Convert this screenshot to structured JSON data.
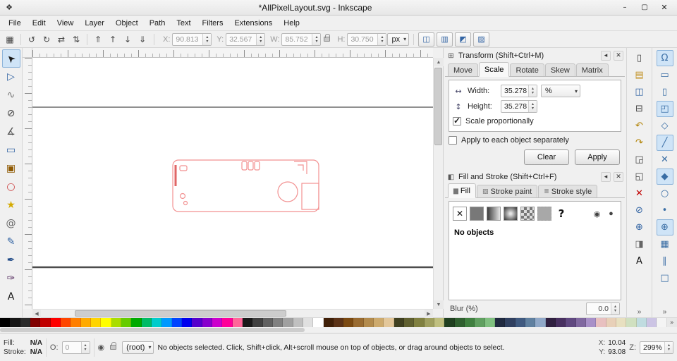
{
  "window": {
    "title": "*AllPixelLayout.svg - Inkscape",
    "icon_glyph": "❖",
    "controls": [
      {
        "name": "minimize-button",
        "glyph": "–"
      },
      {
        "name": "maximize-button",
        "glyph": "▢"
      },
      {
        "name": "close-button",
        "glyph": "✕"
      }
    ]
  },
  "menu": {
    "items": [
      {
        "name": "menu-file",
        "label": "File"
      },
      {
        "name": "menu-edit",
        "label": "Edit"
      },
      {
        "name": "menu-view",
        "label": "View"
      },
      {
        "name": "menu-layer",
        "label": "Layer"
      },
      {
        "name": "menu-object",
        "label": "Object"
      },
      {
        "name": "menu-path",
        "label": "Path"
      },
      {
        "name": "menu-text",
        "label": "Text"
      },
      {
        "name": "menu-filters",
        "label": "Filters"
      },
      {
        "name": "menu-extensions",
        "label": "Extensions"
      },
      {
        "name": "menu-help",
        "label": "Help"
      }
    ]
  },
  "toolbar": {
    "icons": [
      {
        "name": "select-all-button",
        "glyph": "▦"
      },
      {
        "name": "toolbar-separator",
        "cls": "sep"
      },
      {
        "name": "rotate-ccw-button",
        "glyph": "↺"
      },
      {
        "name": "rotate-cw-button",
        "glyph": "↻"
      },
      {
        "name": "flip-horizontal-button",
        "glyph": "⇄"
      },
      {
        "name": "flip-vertical-button",
        "glyph": "⇅"
      },
      {
        "name": "toolbar-separator",
        "cls": "sep"
      },
      {
        "name": "raise-to-top-button",
        "glyph": "⇑"
      },
      {
        "name": "raise-button",
        "glyph": "↑"
      },
      {
        "name": "lower-button",
        "glyph": "↓"
      },
      {
        "name": "lower-to-bottom-button",
        "glyph": "⇓"
      }
    ],
    "x_label": "X:",
    "x_value": "90.813",
    "y_label": "Y:",
    "y_value": "32.567",
    "w_label": "W:",
    "w_value": "85.752",
    "h_label": "H:",
    "h_value": "30.750",
    "unit": "px",
    "affect_toggles": [
      {
        "name": "transform-stroke-toggle",
        "glyph": "◫"
      },
      {
        "name": "transform-corners-toggle",
        "glyph": "▥"
      },
      {
        "name": "transform-gradient-toggle",
        "glyph": "◩"
      },
      {
        "name": "transform-pattern-toggle",
        "glyph": "▨"
      }
    ]
  },
  "toolbox": {
    "tools": [
      {
        "name": "tool-selector",
        "glyph": "➤",
        "fg": "#1a1a1a",
        "rotate": -135,
        "active": true
      },
      {
        "name": "tool-node-editor",
        "glyph": "▷",
        "fg": "#3465a4"
      },
      {
        "name": "tool-tweak",
        "glyph": "∿",
        "fg": "#777777"
      },
      {
        "name": "tool-zoom",
        "glyph": "⊘",
        "fg": "#444444"
      },
      {
        "name": "tool-measure",
        "glyph": "∡",
        "fg": "#555555"
      },
      {
        "name": "tool-rectangle",
        "glyph": "▭",
        "fg": "#3465a4"
      },
      {
        "name": "tool-3dbox",
        "glyph": "▣",
        "fg": "#8f5902"
      },
      {
        "name": "tool-ellipse",
        "glyph": "○",
        "fg": "#cc4444"
      },
      {
        "name": "tool-star",
        "glyph": "★",
        "fg": "#d4aa00"
      },
      {
        "name": "tool-spiral",
        "glyph": "@",
        "fg": "#666666"
      },
      {
        "name": "tool-pencil",
        "glyph": "✎",
        "fg": "#3465a4"
      },
      {
        "name": "tool-bezier-pen",
        "glyph": "✒",
        "fg": "#204a87"
      },
      {
        "name": "tool-calligraphy",
        "glyph": "✑",
        "fg": "#5c3566"
      },
      {
        "name": "tool-text",
        "glyph": "A",
        "fg": "#111111"
      }
    ]
  },
  "transform_panel": {
    "icon_glyph": "⊞",
    "title": "Transform (Shift+Ctrl+M)",
    "collapse_glyph": "◂",
    "close_glyph": "✕",
    "tabs": [
      {
        "name": "tab-move",
        "label": "Move"
      },
      {
        "name": "tab-scale",
        "label": "Scale",
        "active": true
      },
      {
        "name": "tab-rotate",
        "label": "Rotate"
      },
      {
        "name": "tab-skew",
        "label": "Skew"
      },
      {
        "name": "tab-matrix",
        "label": "Matrix"
      }
    ],
    "width_icon": "↔",
    "width_label": "Width:",
    "width_value": "35.278",
    "unit_value": "%",
    "height_icon": "↕",
    "height_label": "Height:",
    "height_value": "35.278",
    "scale_proportionally_label": "Scale proportionally",
    "apply_each_label": "Apply to each object separately",
    "clear_button": "Clear",
    "apply_button": "Apply"
  },
  "fill_stroke_panel": {
    "icon_glyph": "◧",
    "title": "Fill and Stroke (Shift+Ctrl+F)",
    "collapse_glyph": "◂",
    "close_glyph": "✕",
    "tabs": [
      {
        "name": "tab-fill",
        "label": "Fill",
        "glyph": "▆",
        "active": true
      },
      {
        "name": "tab-stroke-paint",
        "label": "Stroke paint",
        "glyph": "▨"
      },
      {
        "name": "tab-stroke-style",
        "label": "Stroke style",
        "glyph": "≣"
      }
    ],
    "paint_buttons": [
      {
        "name": "paint-none-button",
        "cls": "paint-none",
        "glyph": "✕"
      },
      {
        "name": "paint-flat-button",
        "cls": "paint-flat"
      },
      {
        "name": "paint-linear-gradient-button",
        "cls": "paint-linear"
      },
      {
        "name": "paint-radial-gradient-button",
        "cls": "paint-radial"
      },
      {
        "name": "paint-pattern-button",
        "cls": "paint-pattern"
      },
      {
        "name": "paint-swatch-button",
        "cls": "paint-swatch"
      },
      {
        "name": "paint-unknown-button",
        "cls": "paint-unknown",
        "glyph": "?"
      }
    ],
    "fill_rule_buttons": [
      {
        "name": "fill-rule-evenodd-button",
        "glyph": "◉"
      },
      {
        "name": "fill-rule-nonzero-button",
        "glyph": "●"
      }
    ],
    "no_objects_text": "No objects",
    "blur_label": "Blur (%)",
    "blur_value": "0.0"
  },
  "commands_bar": {
    "icons": [
      {
        "name": "new-document-icon",
        "glyph": "▯",
        "fg": "#444444"
      },
      {
        "name": "open-folder-icon",
        "glyph": "▤",
        "fg": "#c09020"
      },
      {
        "name": "save-icon",
        "glyph": "◫",
        "fg": "#3465a4"
      },
      {
        "name": "print-icon",
        "glyph": "⊟",
        "fg": "#444444"
      },
      {
        "name": "undo-icon",
        "glyph": "↶",
        "fg": "#b08000"
      },
      {
        "name": "redo-icon",
        "glyph": "↷",
        "fg": "#b08000"
      },
      {
        "name": "copy-icon",
        "glyph": "◲",
        "fg": "#444444"
      },
      {
        "name": "paste-icon",
        "glyph": "◱",
        "fg": "#444444"
      },
      {
        "name": "delete-icon",
        "glyph": "✕",
        "fg": "#c00000"
      },
      {
        "name": "zoom-drawing-icon",
        "glyph": "⊘",
        "fg": "#3465a4"
      },
      {
        "name": "zoom-page-icon",
        "glyph": "⊕",
        "fg": "#3465a4"
      },
      {
        "name": "fill-stroke-dialog-icon",
        "glyph": "◨",
        "fg": "#666666"
      },
      {
        "name": "text-dialog-icon",
        "glyph": "A",
        "fg": "#111111"
      }
    ],
    "more_glyph": "»"
  },
  "snap_bar": {
    "icons": [
      {
        "name": "snap-toggle-icon",
        "glyph": "Ω",
        "fg": "#3a6ea5",
        "active": true
      },
      {
        "name": "snap-bbox-icon",
        "glyph": "▭",
        "fg": "#3a6ea5"
      },
      {
        "name": "snap-bbox-edges-icon",
        "glyph": "▯",
        "fg": "#3a6ea5"
      },
      {
        "name": "snap-bbox-corners-icon",
        "glyph": "◰",
        "fg": "#3a6ea5",
        "active": true
      },
      {
        "name": "snap-nodes-icon",
        "glyph": "◇",
        "fg": "#3a6ea5"
      },
      {
        "name": "snap-paths-icon",
        "glyph": "╱",
        "fg": "#3a6ea5",
        "active": true
      },
      {
        "name": "snap-intersections-icon",
        "glyph": "✕",
        "fg": "#3a6ea5"
      },
      {
        "name": "snap-cusp-nodes-icon",
        "glyph": "◆",
        "fg": "#3a6ea5",
        "active": true
      },
      {
        "name": "snap-smooth-nodes-icon",
        "glyph": "○",
        "fg": "#3a6ea5"
      },
      {
        "name": "snap-midpoints-icon",
        "glyph": "•",
        "fg": "#3a6ea5"
      },
      {
        "name": "snap-centers-icon",
        "glyph": "⊕",
        "fg": "#3a6ea5",
        "active": true
      },
      {
        "name": "snap-grid-icon",
        "glyph": "▦",
        "fg": "#3a6ea5"
      },
      {
        "name": "snap-guides-icon",
        "glyph": "∥",
        "fg": "#3a6ea5"
      },
      {
        "name": "snap-page-icon",
        "glyph": "□",
        "fg": "#3a6ea5"
      }
    ],
    "more_glyph": "»"
  },
  "palette": {
    "more_glyph": "»",
    "colors": [
      {
        "bg": "#000000"
      },
      {
        "bg": "#161616"
      },
      {
        "bg": "#2b2b2b"
      },
      {
        "bg": "#800000"
      },
      {
        "bg": "#c00000"
      },
      {
        "bg": "#ff0000"
      },
      {
        "bg": "#ff4500"
      },
      {
        "bg": "#ff7f00"
      },
      {
        "bg": "#ffaa00"
      },
      {
        "bg": "#ffd400"
      },
      {
        "bg": "#ffff00"
      },
      {
        "bg": "#aadd00"
      },
      {
        "bg": "#66cc00"
      },
      {
        "bg": "#00aa00"
      },
      {
        "bg": "#00bb66"
      },
      {
        "bg": "#00cccc"
      },
      {
        "bg": "#0099ff"
      },
      {
        "bg": "#0044ff"
      },
      {
        "bg": "#0000ee"
      },
      {
        "bg": "#5500cc"
      },
      {
        "bg": "#8800cc"
      },
      {
        "bg": "#cc00cc"
      },
      {
        "bg": "#ff0099"
      },
      {
        "bg": "#ff6699"
      },
      {
        "bg": "#1a1a1a"
      },
      {
        "bg": "#404040"
      },
      {
        "bg": "#606060"
      },
      {
        "bg": "#808080"
      },
      {
        "bg": "#a0a0a0"
      },
      {
        "bg": "#c0c0c0"
      },
      {
        "bg": "#e0e0e0"
      },
      {
        "bg": "#ffffff"
      },
      {
        "bg": "#402008"
      },
      {
        "bg": "#5c3317"
      },
      {
        "bg": "#7b4a12"
      },
      {
        "bg": "#996b31"
      },
      {
        "bg": "#b38b4d"
      },
      {
        "bg": "#cdaa6d"
      },
      {
        "bg": "#e3c79a"
      },
      {
        "bg": "#404020"
      },
      {
        "bg": "#606030"
      },
      {
        "bg": "#808040"
      },
      {
        "bg": "#a0a060"
      },
      {
        "bg": "#c0c080"
      },
      {
        "bg": "#204020"
      },
      {
        "bg": "#306030"
      },
      {
        "bg": "#408040"
      },
      {
        "bg": "#60a060"
      },
      {
        "bg": "#80c080"
      },
      {
        "bg": "#202a40"
      },
      {
        "bg": "#304060"
      },
      {
        "bg": "#405a80"
      },
      {
        "bg": "#6080a0"
      },
      {
        "bg": "#90a8c8"
      },
      {
        "bg": "#302040"
      },
      {
        "bg": "#483060"
      },
      {
        "bg": "#604880"
      },
      {
        "bg": "#8068a0"
      },
      {
        "bg": "#a890c8"
      },
      {
        "bg": "#e8c0c0"
      },
      {
        "bg": "#e8d0b8"
      },
      {
        "bg": "#e8e0c0"
      },
      {
        "bg": "#d0e0c0"
      },
      {
        "bg": "#c0dce0"
      },
      {
        "bg": "#ccc4e4"
      },
      {
        "bg": "#f4f4f4"
      }
    ]
  },
  "status_bar": {
    "fill_label": "Fill:",
    "fill_value": "N/A",
    "stroke_label": "Stroke:",
    "stroke_value": "N/A",
    "opacity_label": "O:",
    "opacity_value": "0",
    "layer_visibility_glyph": "◉",
    "layer_dropdown": "(root)",
    "message": "No objects selected. Click, Shift+click, Alt+scroll mouse on top of objects, or drag around objects to select.",
    "x_label": "X:",
    "x_value": "10.04",
    "y_label": "Y:",
    "y_value": "93.08",
    "zoom_label": "Z:",
    "zoom_value": "299%"
  }
}
